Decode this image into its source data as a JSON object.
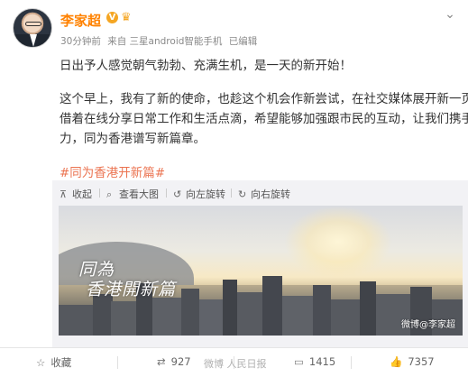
{
  "author": {
    "name": "李家超",
    "verified_badge": "V"
  },
  "meta": {
    "time": "30分钟前",
    "source": "来自 三星android智能手机",
    "edited": "已编辑"
  },
  "post": {
    "line1": "日出予人感觉朝气勃勃、充满生机，是一天的新开始！",
    "line2": "这个早上，我有了新的使命，也趁这个机会作新尝试，在社交媒体展开新一页。",
    "line3": "借着在线分享日常工作和生活点滴，希望能够加强跟市民的互动，让我们携手协",
    "line4": "力，同为香港谱写新篇章。",
    "hashtag": "#同为香港开新篇#"
  },
  "media_toolbar": {
    "collapse": "收起",
    "view_large": "查看大图",
    "rotate_left": "向左旋转",
    "rotate_right": "向右旋转"
  },
  "image": {
    "calligraphy_line1": "同為",
    "calligraphy_line2": "香港開新篇",
    "watermark": "微博@李家超"
  },
  "actions": {
    "favorite": "收藏",
    "repost_count": "927",
    "comment_count": "1415",
    "like_count": "7357"
  },
  "overlay_watermark": "微博 人民日报",
  "colors": {
    "name": "#ff8200",
    "hashtag": "#eb7350",
    "meta": "#8a8a8a"
  },
  "icons": [
    "more-chevron-icon",
    "collapse-icon",
    "zoom-icon",
    "rotate-left-icon",
    "rotate-right-icon",
    "star-icon",
    "repost-icon",
    "comment-icon",
    "like-icon"
  ]
}
